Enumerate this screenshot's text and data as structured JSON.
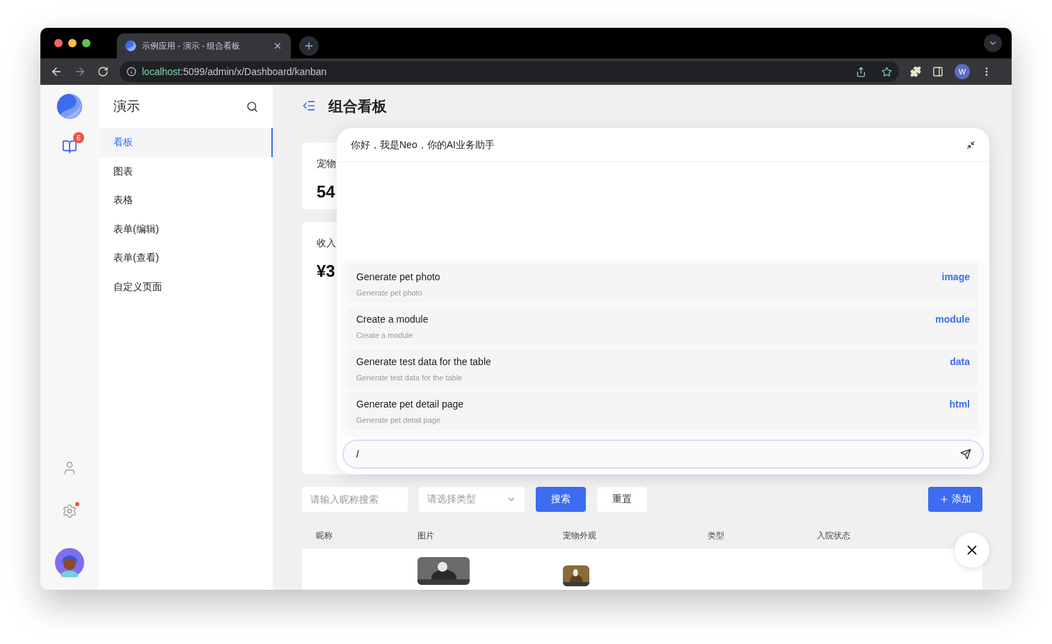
{
  "browser": {
    "tab_title": "示例应用 - 演示 - 组合看板",
    "url_host": "localhost",
    "url_path": ":5099/admin/x/Dashboard/kanban",
    "profile": "W"
  },
  "rail": {
    "badge": "6",
    "settings_dot": true
  },
  "menu": {
    "title": "演示",
    "items": [
      {
        "label": "看板",
        "selected": true
      },
      {
        "label": "图表",
        "selected": false
      },
      {
        "label": "表格",
        "selected": false
      },
      {
        "label": "表单(编辑)",
        "selected": false
      },
      {
        "label": "表单(查看)",
        "selected": false
      },
      {
        "label": "自定义页面",
        "selected": false
      }
    ]
  },
  "page": {
    "title": "组合看板"
  },
  "stat_cards": [
    {
      "label": "宠物",
      "value": "54"
    },
    {
      "label": "收入",
      "value": "¥3"
    }
  ],
  "filters": {
    "name_placeholder": "请输入昵称搜索",
    "type_placeholder": "请选择类型",
    "search_button": "搜索",
    "reset_button": "重置",
    "add_button": "添加"
  },
  "table": {
    "columns": [
      "昵称",
      "图片",
      "宠物外观",
      "类型",
      "入院状态"
    ]
  },
  "assistant": {
    "greeting": "你好，我是Neo，你的AI业务助手",
    "commands": [
      {
        "title": "Generate pet photo",
        "subtitle": "Generate pet photo",
        "tag": "image"
      },
      {
        "title": "Create a module",
        "subtitle": "Create a module",
        "tag": "module"
      },
      {
        "title": "Generate test data for the table",
        "subtitle": "Generate test data for the table",
        "tag": "data"
      },
      {
        "title": "Generate pet detail page",
        "subtitle": "Generate pet detail page",
        "tag": "html"
      }
    ],
    "input": "/"
  }
}
